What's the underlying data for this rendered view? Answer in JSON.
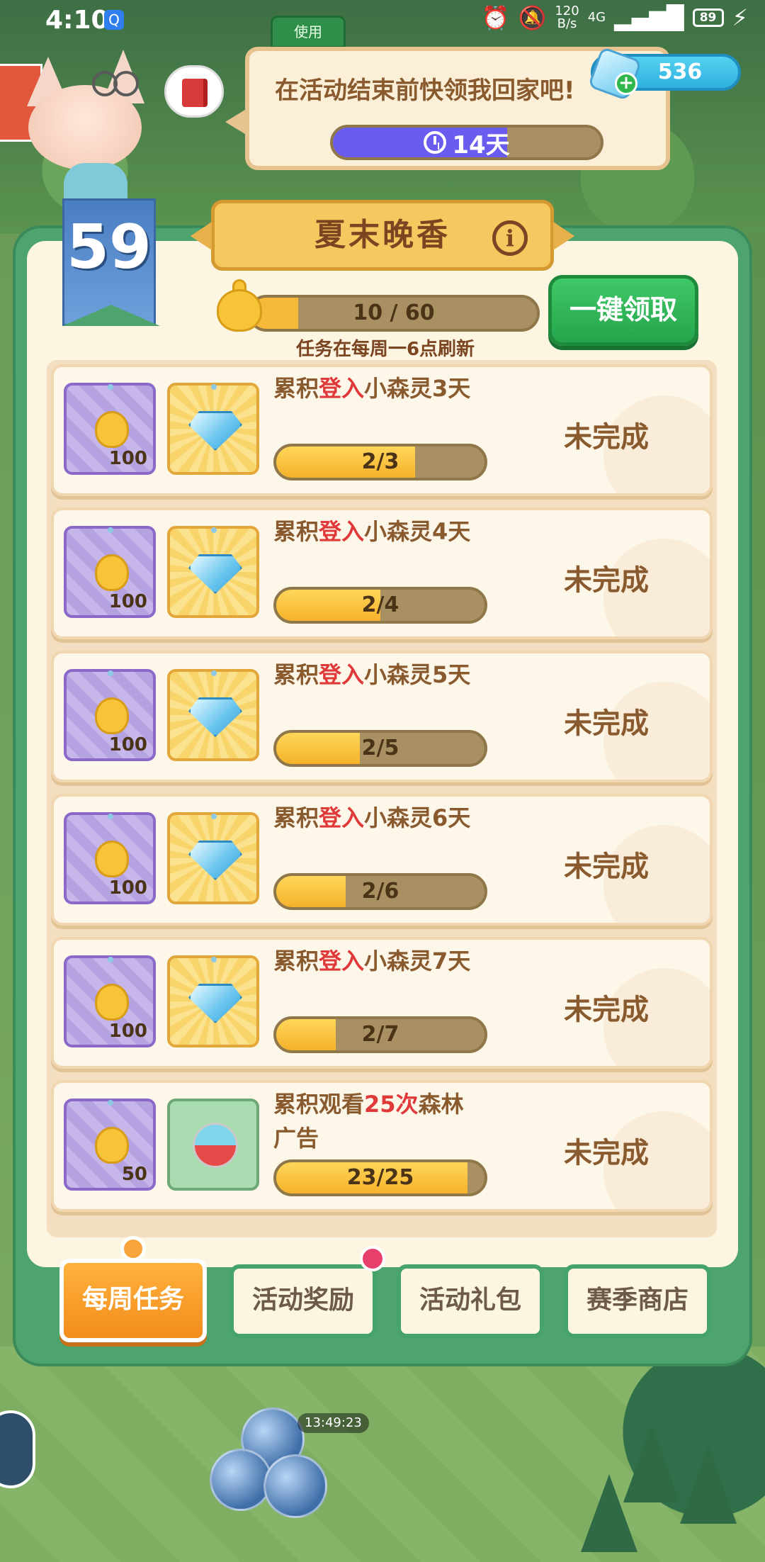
{
  "status_bar": {
    "time": "4:10",
    "app_icon": "Q",
    "alarm_icon": "alarm-icon",
    "mute_icon": "mute-icon",
    "net_speed_value": "120",
    "net_speed_unit": "B/s",
    "network": "4G",
    "signal_icon": "signal-icon",
    "battery": "89",
    "charging_icon": "⚡"
  },
  "use_button": "使用",
  "speech": {
    "text": "在活动结束前快领我回家吧!",
    "timer_label": "14天",
    "timer_fill_fraction": 0.65
  },
  "currency": {
    "gems": "536",
    "plus": "+"
  },
  "level": "59",
  "event_title": "夏末晚香",
  "info_glyph": "i",
  "progress": {
    "current": 10,
    "total": 60,
    "label": "10  /  60",
    "refresh_note": "任务在每周一6点刷新"
  },
  "claim_all_button": "一键领取",
  "tasks": [
    {
      "desc_pre": "累积",
      "desc_hl": "登入",
      "desc_post": "小森灵3天",
      "reward1_qty": "100",
      "reward2": "gem",
      "progress_label": "2/3",
      "fill": 0.667,
      "status": "未完成"
    },
    {
      "desc_pre": "累积",
      "desc_hl": "登入",
      "desc_post": "小森灵4天",
      "reward1_qty": "100",
      "reward2": "gem",
      "progress_label": "2/4",
      "fill": 0.5,
      "status": "未完成"
    },
    {
      "desc_pre": "累积",
      "desc_hl": "登入",
      "desc_post": "小森灵5天",
      "reward1_qty": "100",
      "reward2": "gem",
      "progress_label": "2/5",
      "fill": 0.4,
      "status": "未完成"
    },
    {
      "desc_pre": "累积",
      "desc_hl": "登入",
      "desc_post": "小森灵6天",
      "reward1_qty": "100",
      "reward2": "gem",
      "progress_label": "2/6",
      "fill": 0.333,
      "status": "未完成"
    },
    {
      "desc_pre": "累积",
      "desc_hl": "登入",
      "desc_post": "小森灵7天",
      "reward1_qty": "100",
      "reward2": "gem",
      "progress_label": "2/7",
      "fill": 0.286,
      "status": "未完成"
    },
    {
      "desc_pre": "累积观看",
      "desc_hl": "25次",
      "desc_post": "森林广告",
      "reward1_qty": "50",
      "reward2": "capsule",
      "progress_label": "23/25",
      "fill": 0.92,
      "status": "未完成"
    }
  ],
  "tabs": [
    {
      "label": "每周任务",
      "active": true
    },
    {
      "label": "活动奖励",
      "active": false
    },
    {
      "label": "活动礼包",
      "active": false
    },
    {
      "label": "赛季商店",
      "active": false
    }
  ],
  "background_timer": "13:49:23",
  "colors": {
    "panel_green": "#4ea46e",
    "claim_green": "#25a44b",
    "active_tab_orange": "#f28c1c",
    "highlight_red": "#e0393a",
    "bar_yellow": "#f5b22a",
    "timer_purple": "#6b5cf0"
  }
}
